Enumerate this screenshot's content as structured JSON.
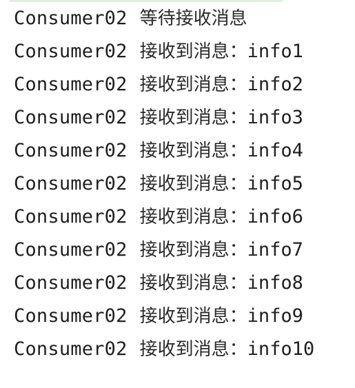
{
  "console": {
    "lines": [
      {
        "sender": "Consumer02",
        "message": "等待接收消息",
        "payload": ""
      },
      {
        "sender": "Consumer02",
        "message": "接收到消息：",
        "payload": "info1"
      },
      {
        "sender": "Consumer02",
        "message": "接收到消息：",
        "payload": "info2"
      },
      {
        "sender": "Consumer02",
        "message": "接收到消息：",
        "payload": "info3"
      },
      {
        "sender": "Consumer02",
        "message": "接收到消息：",
        "payload": "info4"
      },
      {
        "sender": "Consumer02",
        "message": "接收到消息：",
        "payload": "info5"
      },
      {
        "sender": "Consumer02",
        "message": "接收到消息：",
        "payload": "info6"
      },
      {
        "sender": "Consumer02",
        "message": "接收到消息：",
        "payload": "info7"
      },
      {
        "sender": "Consumer02",
        "message": "接收到消息：",
        "payload": "info8"
      },
      {
        "sender": "Consumer02",
        "message": "接收到消息：",
        "payload": "info9"
      },
      {
        "sender": "Consumer02",
        "message": "接收到消息：",
        "payload": "info10"
      }
    ]
  }
}
